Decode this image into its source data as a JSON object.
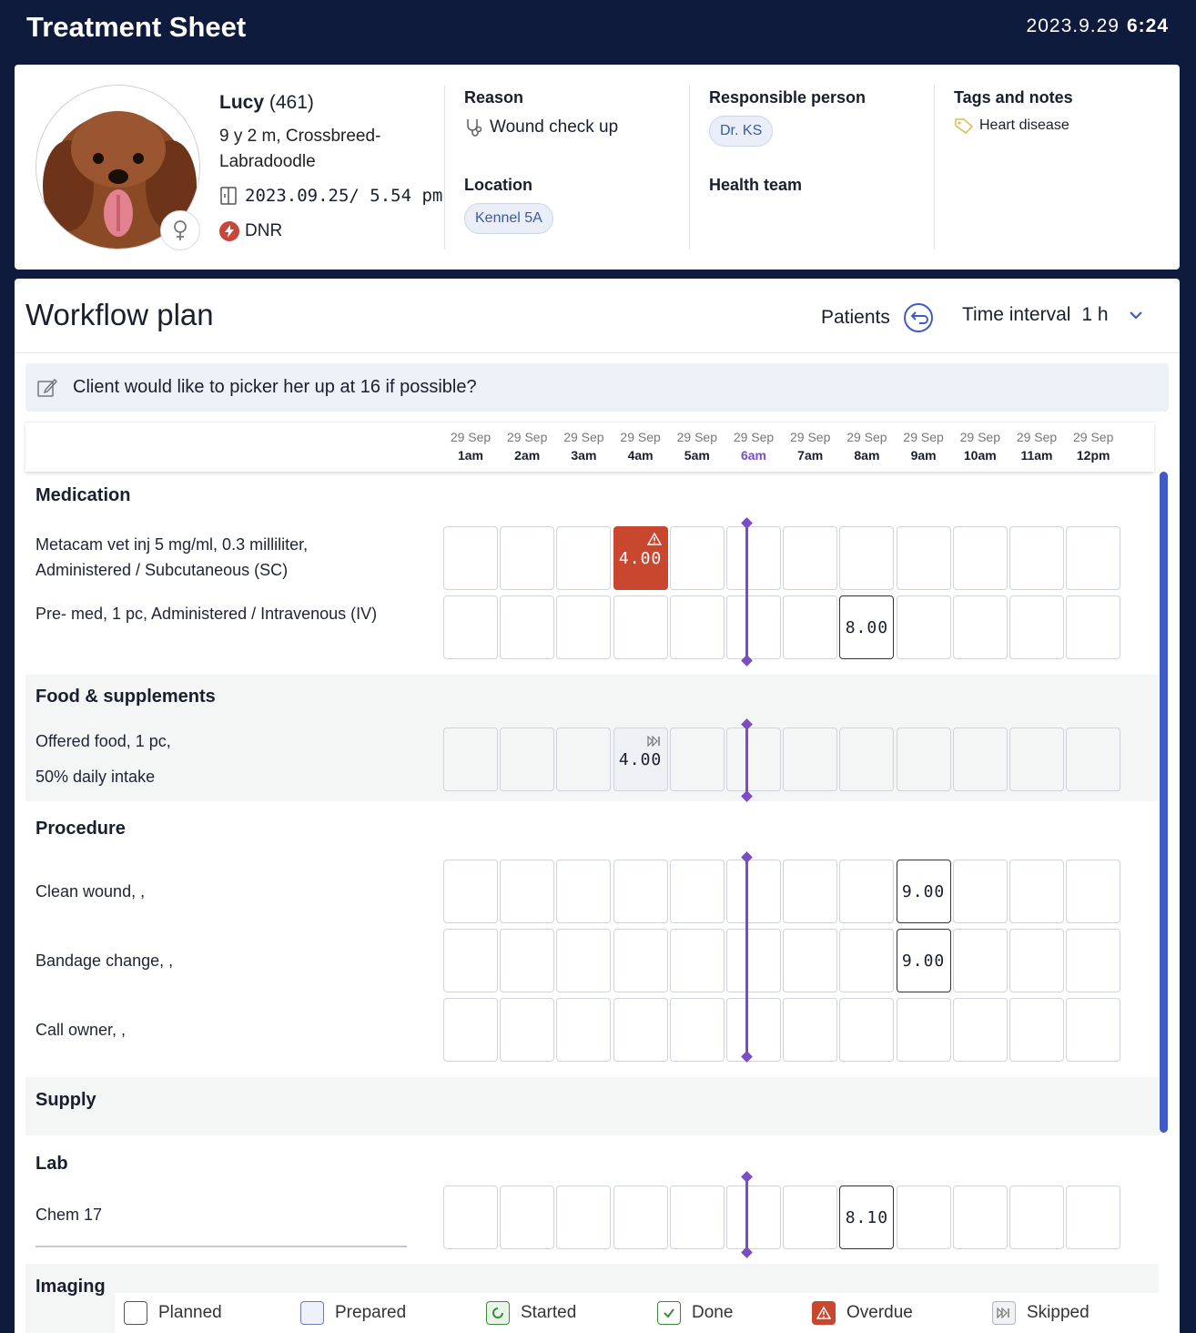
{
  "header": {
    "title": "Treatment Sheet",
    "date": "2023.9.29",
    "time": "6:24"
  },
  "patient": {
    "name": "Lucy",
    "id": "(461)",
    "age_breed": "9 y 2 m, Crossbreed-Labradoodle",
    "admitted": "2023.09.25/ 5.54 pm",
    "dnr_label": "DNR",
    "sex_icon": "female-icon",
    "reason_label": "Reason",
    "reason_value": "Wound check up",
    "location_label": "Location",
    "location_value": "Kennel 5A",
    "responsible_label": "Responsible person",
    "responsible_value": "Dr. KS",
    "health_team_label": "Health team",
    "tags_label": "Tags and notes",
    "tags_value": "Heart disease"
  },
  "workflow": {
    "title": "Workflow plan",
    "patients_label": "Patients",
    "interval_label": "Time interval",
    "interval_value": "1 h",
    "note": "Client would like to picker her up at 16 if possible?",
    "columns": [
      {
        "date": "29 Sep",
        "time": "1am"
      },
      {
        "date": "29 Sep",
        "time": "2am"
      },
      {
        "date": "29 Sep",
        "time": "3am"
      },
      {
        "date": "29 Sep",
        "time": "4am"
      },
      {
        "date": "29 Sep",
        "time": "5am"
      },
      {
        "date": "29 Sep",
        "time": "6am"
      },
      {
        "date": "29 Sep",
        "time": "7am"
      },
      {
        "date": "29 Sep",
        "time": "8am"
      },
      {
        "date": "29 Sep",
        "time": "9am"
      },
      {
        "date": "29 Sep",
        "time": "10am"
      },
      {
        "date": "29 Sep",
        "time": "11am"
      },
      {
        "date": "29 Sep",
        "time": "12pm"
      }
    ],
    "current_column": 5,
    "groups": {
      "medication": {
        "title": "Medication",
        "rows": [
          {
            "label": "Metacam vet inj 5 mg/ml, 0.3 milliliter, Administered / Subcutaneous (SC)",
            "cells": {
              "3": {
                "value": "4.00",
                "status": "overdue"
              }
            }
          },
          {
            "label": "Pre- med, 1 pc, Administered / Intravenous (IV)",
            "cells": {
              "7": {
                "value": "8.00",
                "status": "planned"
              }
            }
          }
        ]
      },
      "food": {
        "title": "Food & supplements",
        "rows": [
          {
            "label": "Offered food, 1 pc,",
            "label2": "50% daily intake",
            "cells": {
              "3": {
                "value": "4.00",
                "status": "skipped"
              }
            }
          }
        ]
      },
      "procedure": {
        "title": "Procedure",
        "rows": [
          {
            "label": "Clean wound, ,",
            "cells": {
              "8": {
                "value": "9.00",
                "status": "planned"
              }
            }
          },
          {
            "label": "Bandage change, ,",
            "cells": {
              "8": {
                "value": "9.00",
                "status": "planned"
              }
            }
          },
          {
            "label": "Call owner, ,",
            "cells": {}
          }
        ]
      },
      "supply": {
        "title": "Supply"
      },
      "lab": {
        "title": "Lab",
        "rows": [
          {
            "label": "Chem 17",
            "cells": {
              "7": {
                "value": "8.10",
                "status": "planned"
              }
            }
          }
        ]
      },
      "imaging": {
        "title": "Imaging"
      }
    }
  },
  "legend": [
    {
      "label": "Planned",
      "icon": "planned-icon"
    },
    {
      "label": "Prepared",
      "icon": "prepared-icon"
    },
    {
      "label": "Started",
      "icon": "started-icon"
    },
    {
      "label": "Done",
      "icon": "done-icon"
    },
    {
      "label": "Overdue",
      "icon": "overdue-icon"
    },
    {
      "label": "Skipped",
      "icon": "skipped-icon"
    }
  ],
  "colors": {
    "nav": "#0f1b3d",
    "overdue": "#c9472e",
    "now": "#7b4cc4",
    "accent": "#3f5cc6"
  }
}
